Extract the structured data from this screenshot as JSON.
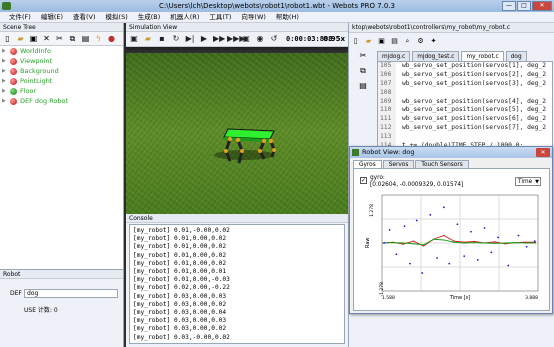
{
  "window": {
    "title": "C:\\Users\\lch\\Desktop\\webots\\robot1\\robot1.wbt - Webots PRO 7.0.3",
    "minimize": "—",
    "maximize": "□",
    "close": "✕"
  },
  "menu": [
    "文件(F)",
    "编辑(E)",
    "查看(V)",
    "模拟(S)",
    "生成(B)",
    "机器人(R)",
    "工具(T)",
    "向导(W)",
    "帮助(H)"
  ],
  "scene_tree": {
    "title": "Scene Tree",
    "items": [
      {
        "label": "WorldInfo",
        "kind": "node"
      },
      {
        "label": "Viewpoint",
        "kind": "node"
      },
      {
        "label": "Background",
        "kind": "node"
      },
      {
        "label": "PointLight",
        "kind": "node"
      },
      {
        "label": "Floor",
        "kind": "floor"
      },
      {
        "label": "DEF dog Robot",
        "kind": "robot"
      }
    ]
  },
  "robot_panel": {
    "title": "Robot",
    "def_label": "DEF",
    "def_value": "dog",
    "use_label": "USE 计数: 0"
  },
  "simulation": {
    "title": "Simulation View",
    "time": "0:00:03:888",
    "speed": "0.95x"
  },
  "console": {
    "title": "Console",
    "lines": [
      "[my_robot] 0.01,-0.00,0.02",
      "[my_robot] 0.01,0.00,0.02",
      "[my_robot] 0.01,0.00,0.02",
      "[my_robot] 0.01,0.00,0.02",
      "[my_robot] 0.01,0.00,0.02",
      "[my_robot] 0.01,0.00,0.01",
      "[my_robot] 0.01,0.00,-0.03",
      "[my_robot] 0.02,0.00,-0.22",
      "[my_robot] 0.03,0.00,0.03",
      "[my_robot] 0.03,0.00,0.02",
      "[my_robot] 0.03,0.00,0.04",
      "[my_robot] 0.03,0.00,0.03",
      "[my_robot] 0.03,0.00,0.02",
      "[my_robot] 0.03,-0.00,0.02"
    ]
  },
  "editor": {
    "path": "ktop\\webots\\robot1\\controllers\\my_robot\\my_robot.c",
    "tabs": [
      "mjdog.c",
      "mjdog_test.c",
      "my_robot.c",
      "dog"
    ],
    "active_tab": 2,
    "code": [
      {
        "num": "105",
        "text": "wb_servo_set_position(servos[1], deg_2"
      },
      {
        "num": "106",
        "text": "wb_servo_set_position(servos[2], deg_2"
      },
      {
        "num": "107",
        "text": "wb_servo_set_position(servos[3], deg_2"
      },
      {
        "num": "108",
        "text": ""
      },
      {
        "num": "109",
        "text": "wb_servo_set_position(servos[4], deg_2"
      },
      {
        "num": "110",
        "text": "wb_servo_set_position(servos[5], deg_2"
      },
      {
        "num": "111",
        "text": "wb_servo_set_position(servos[6], deg_2"
      },
      {
        "num": "112",
        "text": "wb_servo_set_position(servos[7], deg_2"
      },
      {
        "num": "113",
        "text": ""
      },
      {
        "num": "114",
        "text": "t += (double)TIME_STEP / 1000.0;"
      },
      {
        "num": "115",
        "text": ""
      },
      {
        "num": "116",
        "text": ""
      }
    ]
  },
  "robot_view": {
    "title": "Robot View: dog",
    "tabs": [
      "Gyros",
      "Servos",
      "Touch Sensors"
    ],
    "active_tab": 0,
    "gyro_label": "gyro:",
    "gyro_values": "[0.02604, -0.0009329, 0.01574]",
    "mode": "Time",
    "checked": "✓"
  },
  "chart_data": {
    "type": "scatter",
    "title": "",
    "xlabel": "Time [s]",
    "ylabel": "Raw",
    "xlim": [
      1.588,
      3.888
    ],
    "ylim": [
      -1.278,
      1.278
    ],
    "x_ticks": [
      "1.588",
      "3.888"
    ],
    "y_ticks": [
      "1.278",
      "-1.278"
    ],
    "grid": true,
    "series": [
      {
        "color": "#d01818",
        "x": [
          1.6,
          1.75,
          1.9,
          2.05,
          2.2,
          2.35,
          2.5,
          2.65,
          2.8,
          2.95,
          3.1,
          3.25,
          3.4,
          3.55,
          3.7,
          3.85
        ],
        "y": [
          0.0,
          0.02,
          -0.03,
          0.05,
          -0.08,
          0.1,
          0.2,
          0.05,
          0.02,
          0.04,
          0.0,
          0.03,
          -0.02,
          0.01,
          0.02,
          0.02
        ]
      },
      {
        "color": "#18a018",
        "x": [
          1.6,
          1.75,
          1.9,
          2.05,
          2.2,
          2.35,
          2.5,
          2.65,
          2.8,
          2.95,
          3.1,
          3.25,
          3.4,
          3.55,
          3.7,
          3.85
        ],
        "y": [
          0.0,
          0.01,
          0.0,
          -0.02,
          -0.05,
          0.1,
          0.08,
          0.02,
          0.0,
          0.01,
          0.0,
          -0.01,
          0.0,
          0.01,
          0.0,
          0.0
        ]
      },
      {
        "color": "#1818c8",
        "x": [
          1.62,
          1.7,
          1.8,
          1.92,
          2.0,
          2.1,
          2.18,
          2.3,
          2.4,
          2.5,
          2.58,
          2.7,
          2.8,
          2.9,
          3.0,
          3.1,
          3.2,
          3.3,
          3.45,
          3.6,
          3.72,
          3.84
        ],
        "y": [
          0.0,
          0.35,
          -0.3,
          0.45,
          -0.55,
          0.6,
          -0.8,
          0.75,
          -0.4,
          0.95,
          -0.55,
          0.5,
          -0.35,
          0.3,
          -0.45,
          0.4,
          -0.25,
          0.15,
          -0.6,
          0.2,
          -0.1,
          0.05
        ]
      }
    ]
  }
}
